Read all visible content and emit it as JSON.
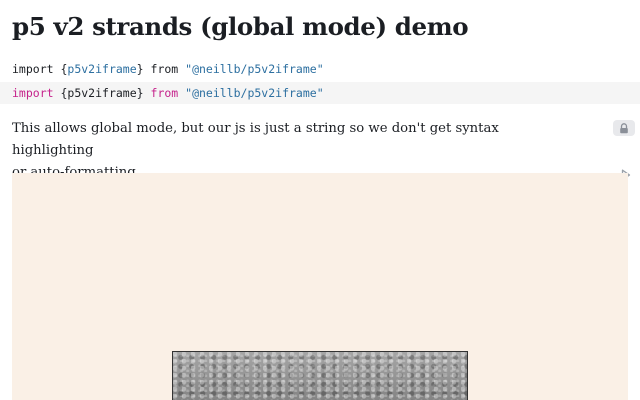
{
  "page": {
    "title": "p5 v2 strands (global mode) demo"
  },
  "cell_output": {
    "keyword": "import",
    "open_brace": " {",
    "identifier": "p5v2iframe",
    "close_brace": "} ",
    "from": "from",
    "module": " \"@neillb/p5v2iframe\""
  },
  "cell_source": {
    "keyword": "import",
    "open_brace": " {",
    "identifier": "p5v2iframe",
    "close_brace": "} ",
    "from": "from",
    "module": " \"@neillb/p5v2iframe\""
  },
  "description": {
    "line1": "This allows global mode, but our js is just a string so we don't get syntax highlighting",
    "line2": "or auto-formatting."
  },
  "icons": {
    "lock": "lock-icon",
    "run": "play-icon"
  },
  "colors": {
    "keyword_source": "#c5228b",
    "identifier_output": "#2c6fa0",
    "canvas_background": "#faf0e6",
    "source_cell_background": "#f5f5f5"
  }
}
